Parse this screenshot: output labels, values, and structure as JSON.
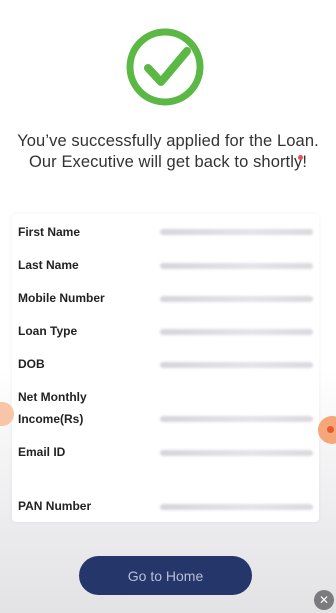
{
  "success": {
    "icon": "check-circle-icon",
    "icon_color": "#5cb845",
    "message": "You’ve successfully applied for the Loan. Our Executive will get back to shortly!"
  },
  "details": {
    "rows": [
      {
        "label": "First Name"
      },
      {
        "label": "Last Name"
      },
      {
        "label": "Mobile Number"
      },
      {
        "label": "Loan Type"
      },
      {
        "label": "DOB"
      },
      {
        "label": "Net Monthly Income(Rs)"
      },
      {
        "label": "Email ID"
      },
      {
        "label": "PAN Number"
      }
    ]
  },
  "actions": {
    "home_label": "Go to Home",
    "home_color": "#25376a",
    "close_icon": "close-icon",
    "close_glyph": "✕"
  }
}
